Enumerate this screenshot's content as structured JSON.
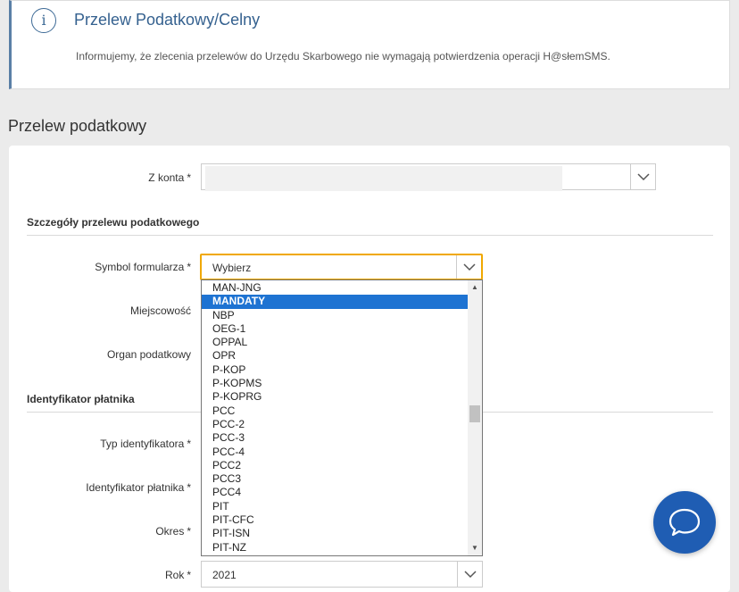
{
  "info": {
    "icon": "info-icon",
    "icon_glyph": "i",
    "title": "Przelew Podatkowy/Celny",
    "text": "Informujemy, że zlecenia przelewów do Urzędu Skarbowego nie wymagają potwierdzenia operacji H@słemSMS."
  },
  "section_title": "Przelew podatkowy",
  "form": {
    "z_konta_label": "Z konta",
    "details_heading": "Szczegóły przelewu podatkowego",
    "symbol_label": "Symbol formularza",
    "symbol_value": "Wybierz",
    "miejscowosc_label": "Miejscowość",
    "organ_label": "Organ podatkowy",
    "payer_heading": "Identyfikator płatnika",
    "typ_id_label": "Typ identyfikatora",
    "id_platnika_label": "Identyfikator płatnika",
    "okres_label": "Okres",
    "rok_label": "Rok",
    "rok_value": "2021",
    "required_mark": "*"
  },
  "dropdown": {
    "selected": "MANDATY",
    "options": [
      "MAN-JNG",
      "MANDATY",
      "NBP",
      "OEG-1",
      "OPPAL",
      "OPR",
      "P-KOP",
      "P-KOPMS",
      "P-KOPRG",
      "PCC",
      "PCC-2",
      "PCC-3",
      "PCC-4",
      "PCC2",
      "PCC3",
      "PCC4",
      "PIT",
      "PIT-CFC",
      "PIT-ISN",
      "PIT-NZ"
    ]
  },
  "colors": {
    "accent": "#1f5db3",
    "focus": "#f0a800",
    "selected_option": "#1e73d2"
  }
}
